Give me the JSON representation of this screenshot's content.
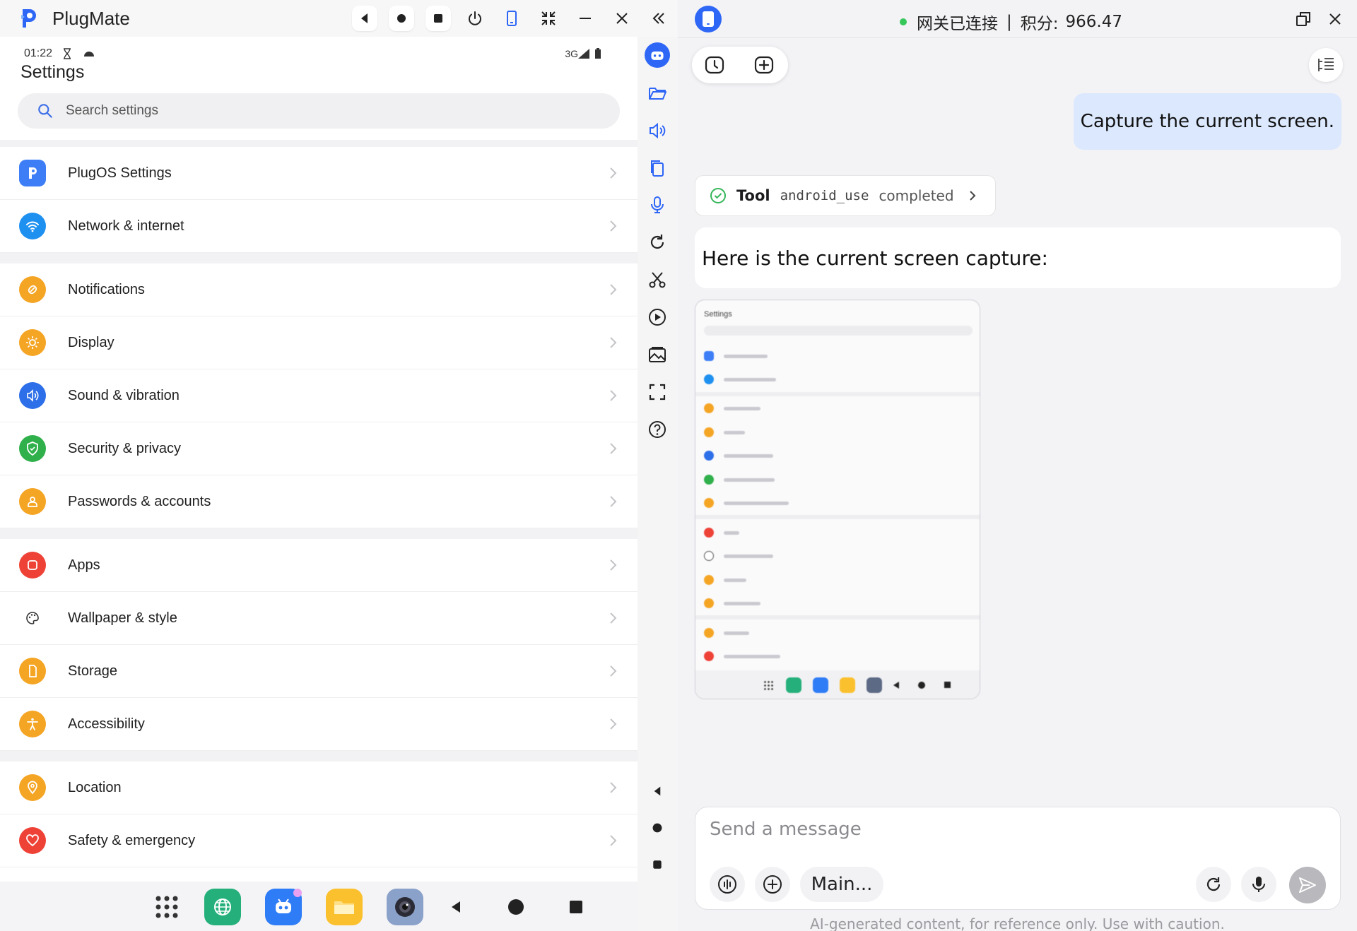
{
  "left_window": {
    "app_title": "PlugMate",
    "controls": [
      "back-icon",
      "circle-icon",
      "stop-icon",
      "power-icon",
      "phone-icon",
      "collapse-icon",
      "minimize-icon",
      "close-icon",
      "double-chevron-left-icon"
    ]
  },
  "phone": {
    "status": {
      "time": "01:22",
      "network": "3G"
    },
    "page_title": "Settings",
    "search_placeholder": "Search settings",
    "groups": [
      [
        {
          "label": "PlugOS Settings",
          "icon": "plugos-icon",
          "color": "#3d7ef7"
        },
        {
          "label": "Network & internet",
          "icon": "wifi-icon",
          "color": "#1e90f0"
        }
      ],
      [
        {
          "label": "Notifications",
          "icon": "bell-icon",
          "color": "#f5a524"
        },
        {
          "label": "Display",
          "icon": "sun-icon",
          "color": "#f5a524"
        },
        {
          "label": "Sound & vibration",
          "icon": "speaker-icon",
          "color": "#2d6fe8"
        },
        {
          "label": "Security & privacy",
          "icon": "shield-icon",
          "color": "#2fb04b"
        },
        {
          "label": "Passwords & accounts",
          "icon": "person-icon",
          "color": "#f5a524"
        }
      ],
      [
        {
          "label": "Apps",
          "icon": "apps-icon",
          "color": "#ee4237"
        },
        {
          "label": "Wallpaper & style",
          "icon": "palette-icon",
          "color": "#ffffff"
        },
        {
          "label": "Storage",
          "icon": "storage-icon",
          "color": "#f5a524"
        },
        {
          "label": "Accessibility",
          "icon": "accessibility-icon",
          "color": "#f5a524"
        }
      ],
      [
        {
          "label": "Location",
          "icon": "location-pin-icon",
          "color": "#f5a524"
        },
        {
          "label": "Safety & emergency",
          "icon": "heart-icon",
          "color": "#ee4237"
        }
      ]
    ]
  },
  "chat": {
    "status_text": "网关已连接",
    "separator": "|",
    "points_label": "积分:",
    "points_value": "966.47",
    "user_message": "Capture the current screen.",
    "tool_card": {
      "label": "Tool",
      "tool_name": "android_use",
      "status": "completed"
    },
    "assistant_message": "Here is the current screen capture:",
    "screenshot_title": "Settings",
    "composer_placeholder": "Send a message",
    "model_label": "Main...",
    "disclaimer": "AI-generated content, for reference only. Use with caution."
  },
  "colors": {
    "accent": "#2e66f6",
    "connected": "#35c759",
    "user_bubble": "#dbe8fd"
  }
}
